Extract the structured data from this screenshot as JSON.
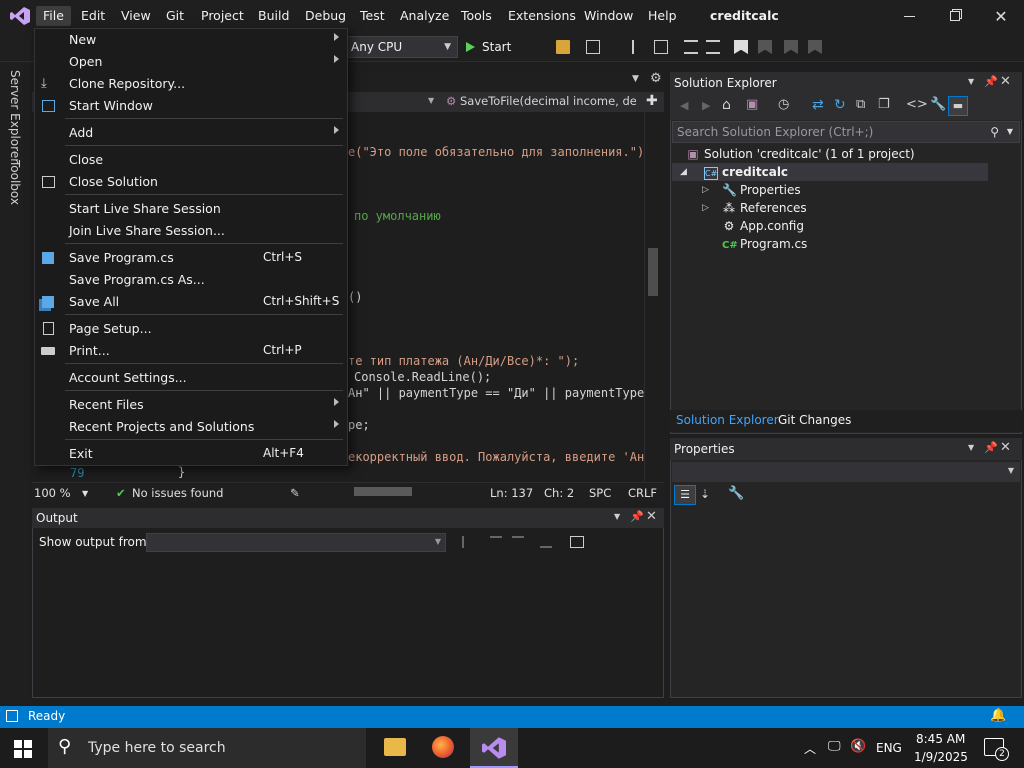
{
  "title_bar": {
    "menus": [
      "File",
      "Edit",
      "View",
      "Git",
      "Project",
      "Build",
      "Debug",
      "Test",
      "Analyze",
      "Tools",
      "Extensions",
      "Window",
      "Help"
    ],
    "app_title": "creditcalc"
  },
  "toolbar": {
    "platform": "Any CPU",
    "start_label": "Start"
  },
  "left_rail": {
    "server_explorer": "Server Explorer",
    "toolbox": "Toolbox"
  },
  "editor": {
    "method_dropdown": "SaveToFile(decimal income, dec",
    "lines": [
      {
        "text": "e(\"Это поле обязательно для заполнения.\");"
      },
      {
        "text": "по умолчанию"
      },
      {
        "text": "()"
      },
      {
        "text": "те тип платежа (Ан/Ди/Все)*: \");"
      },
      {
        "text": "Console.ReadLine();"
      },
      {
        "text": "Ан\" || paymentType == \"Ди\" || paymentType ="
      },
      {
        "text": "pe;"
      },
      {
        "text": "екорректный ввод. Пожалуйста, введите 'Ан',"
      },
      {
        "lineno": "79",
        "text": "}"
      }
    ],
    "status": {
      "zoom": "100 %",
      "issues": "No issues found",
      "line": "Ln: 137",
      "col": "Ch: 2",
      "spc": "SPC",
      "eol": "CRLF"
    }
  },
  "output_panel": {
    "title": "Output",
    "show_from_label": "Show output from:"
  },
  "solution_explorer": {
    "title": "Solution Explorer",
    "search_placeholder": "Search Solution Explorer (Ctrl+;)",
    "solution": "Solution 'creditcalc' (1 of 1 project)",
    "project": "creditcalc",
    "items": [
      "Properties",
      "References",
      "App.config",
      "Program.cs"
    ],
    "tabs": [
      "Solution Explorer",
      "Git Changes"
    ]
  },
  "properties_panel": {
    "title": "Properties"
  },
  "file_menu": {
    "items": [
      {
        "label": "New",
        "submenu": true
      },
      {
        "label": "Open",
        "submenu": true
      },
      {
        "label": "Clone Repository...",
        "icon": "clone-icon"
      },
      {
        "label": "Start Window",
        "icon": "start-window-icon"
      },
      {
        "label": "Add",
        "submenu": true
      },
      {
        "label": "Close"
      },
      {
        "label": "Close Solution",
        "icon": "close-solution-icon"
      },
      {
        "label": "Start Live Share Session"
      },
      {
        "label": "Join Live Share Session..."
      },
      {
        "label": "Save Program.cs",
        "shortcut": "Ctrl+S",
        "icon": "save-icon"
      },
      {
        "label": "Save Program.cs As..."
      },
      {
        "label": "Save All",
        "shortcut": "Ctrl+Shift+S",
        "icon": "save-all-icon"
      },
      {
        "label": "Page Setup...",
        "icon": "page-setup-icon"
      },
      {
        "label": "Print...",
        "shortcut": "Ctrl+P",
        "icon": "print-icon"
      },
      {
        "label": "Account Settings..."
      },
      {
        "label": "Recent Files",
        "submenu": true
      },
      {
        "label": "Recent Projects and Solutions",
        "submenu": true
      },
      {
        "label": "Exit",
        "shortcut": "Alt+F4"
      }
    ]
  },
  "status_bar": {
    "state": "Ready"
  },
  "taskbar": {
    "search_placeholder": "Type here to search",
    "language": "ENG",
    "time": "8:45 AM",
    "date": "1/9/2025",
    "notification_count": "2"
  },
  "colors": {
    "accent": "#007acc",
    "menu_bg": "#1b1b1c",
    "start_green": "#5ad15a"
  }
}
